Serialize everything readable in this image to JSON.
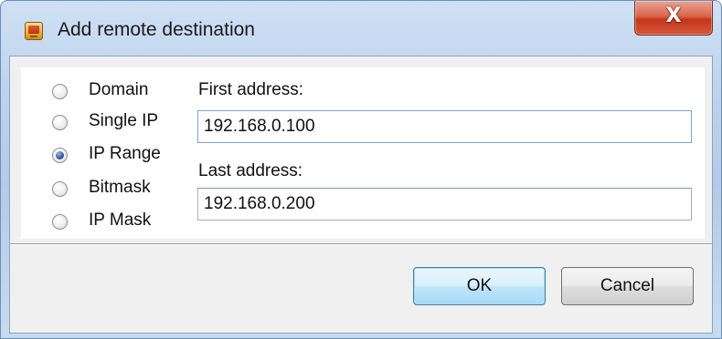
{
  "window": {
    "title": "Add remote destination",
    "app_icon": "remote-destination-icon",
    "close_glyph": "X"
  },
  "radios": [
    {
      "label": "Domain",
      "checked": false
    },
    {
      "label": "Single IP",
      "checked": false
    },
    {
      "label": "IP Range",
      "checked": true
    },
    {
      "label": "Bitmask",
      "checked": false
    },
    {
      "label": "IP Mask",
      "checked": false
    }
  ],
  "fields": {
    "first_label": "First address:",
    "first_value": "192.168.0.100",
    "last_label": "Last address:",
    "last_value": "192.168.0.200"
  },
  "buttons": {
    "ok": "OK",
    "cancel": "Cancel"
  },
  "colors": {
    "default_button_accent": "#3c7fb1",
    "close_button": "#c2371c",
    "titlebar": "#bcd3ee"
  }
}
